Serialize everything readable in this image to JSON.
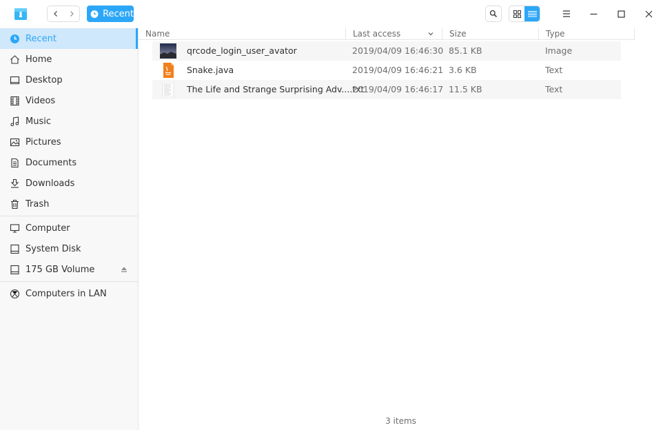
{
  "titlebar": {
    "breadcrumb": "Recent",
    "accent_color": "#2ca7f8"
  },
  "sidebar": {
    "groups": [
      [
        {
          "label": "Recent",
          "icon": "clock-icon",
          "active": true
        },
        {
          "label": "Home",
          "icon": "home-icon"
        },
        {
          "label": "Desktop",
          "icon": "desktop-icon"
        },
        {
          "label": "Videos",
          "icon": "film-icon"
        },
        {
          "label": "Music",
          "icon": "music-note-icon"
        },
        {
          "label": "Pictures",
          "icon": "image-icon"
        },
        {
          "label": "Documents",
          "icon": "document-icon"
        },
        {
          "label": "Downloads",
          "icon": "download-icon"
        },
        {
          "label": "Trash",
          "icon": "trash-icon"
        }
      ],
      [
        {
          "label": "Computer",
          "icon": "computer-icon"
        },
        {
          "label": "System Disk",
          "icon": "disk-icon"
        },
        {
          "label": "175 GB Volume",
          "icon": "disk-icon",
          "ejectable": true
        }
      ],
      [
        {
          "label": "Computers in LAN",
          "icon": "network-icon"
        }
      ]
    ]
  },
  "columns": {
    "name": "Name",
    "last_access": "Last access",
    "size": "Size",
    "type": "Type"
  },
  "files": [
    {
      "name": "qrcode_login_user_avator",
      "last_access": "2019/04/09 16:46:30",
      "size": "85.1 KB",
      "type": "Image",
      "thumb": "image-thumbnail"
    },
    {
      "name": "Snake.java",
      "last_access": "2019/04/09 16:46:21",
      "size": "3.6 KB",
      "type": "Text",
      "thumb": "java-file-icon"
    },
    {
      "name": "The Life and Strange Surprising Adv....txt",
      "last_access": "2019/04/09 16:46:17",
      "size": "11.5 KB",
      "type": "Text",
      "thumb": "text-file-icon"
    }
  ],
  "status": {
    "item_count": "3 items"
  }
}
